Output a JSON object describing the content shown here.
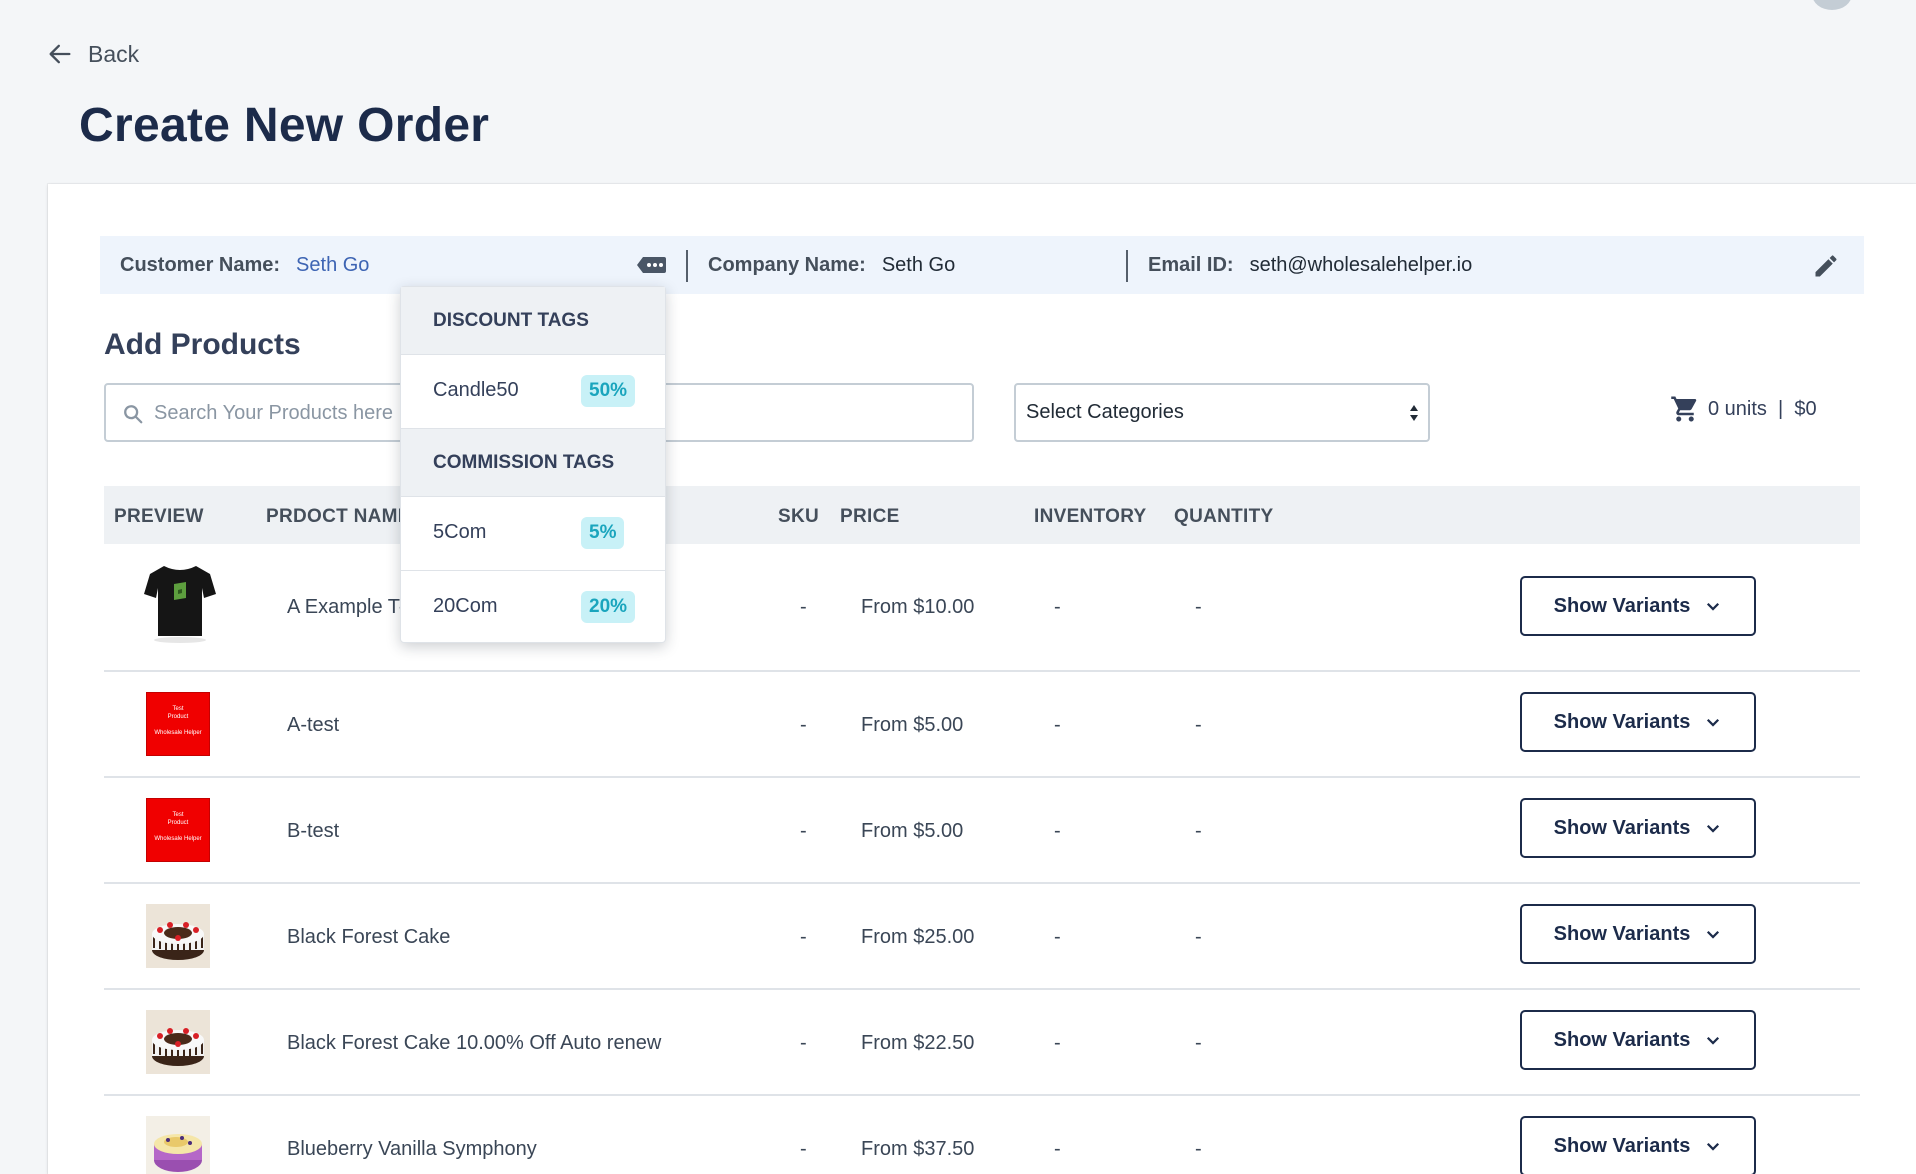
{
  "nav": {
    "back_label": "Back"
  },
  "page": {
    "title": "Create New Order"
  },
  "customer": {
    "customer_label": "Customer Name:",
    "customer_value": "Seth Go",
    "company_label": "Company Name:",
    "company_value": "Seth Go",
    "email_label": "Email ID:",
    "email_value": "seth@wholesalehelper.io"
  },
  "products": {
    "section_title": "Add Products",
    "search_placeholder": "Search Your Products here",
    "category_select": "Select Categories",
    "cart_summary": "0 units  |  $0"
  },
  "table": {
    "headers": {
      "preview": "PREVIEW",
      "name": "PRDOCT NAME",
      "sku": "SKU",
      "price": "PRICE",
      "inventory": "INVENTORY",
      "quantity": "QUANTITY"
    },
    "variants_label": "Show Variants",
    "rows": [
      {
        "name": "A Example T-Shirt",
        "sku": "-",
        "price": "From $10.00",
        "inventory": "-",
        "quantity": "-",
        "thumb": "tshirt-image"
      },
      {
        "name": "A-test",
        "sku": "-",
        "price": "From $5.00",
        "inventory": "-",
        "quantity": "-",
        "thumb": "test-product-image"
      },
      {
        "name": "B-test",
        "sku": "-",
        "price": "From $5.00",
        "inventory": "-",
        "quantity": "-",
        "thumb": "test-product-image"
      },
      {
        "name": "Black Forest Cake",
        "sku": "-",
        "price": "From $25.00",
        "inventory": "-",
        "quantity": "-",
        "thumb": "cake-image"
      },
      {
        "name": "Black Forest Cake 10.00% Off Auto renew",
        "sku": "-",
        "price": "From $22.50",
        "inventory": "-",
        "quantity": "-",
        "thumb": "cake-image"
      },
      {
        "name": "Blueberry Vanilla Symphony",
        "sku": "-",
        "price": "From $37.50",
        "inventory": "-",
        "quantity": "-",
        "thumb": "blueberry-cake-image"
      }
    ]
  },
  "tag_popover": {
    "discount_heading": "DISCOUNT TAGS",
    "discount_tags": [
      {
        "name": "Candle50",
        "percent": "50%"
      }
    ],
    "commission_heading": "COMMISSION TAGS",
    "commission_tags": [
      {
        "name": "5Com",
        "percent": "5%"
      },
      {
        "name": "20Com",
        "percent": "20%"
      }
    ]
  },
  "thumb_text": {
    "line1": "Test",
    "line2": "Product",
    "line3": "Wholesale Helper"
  },
  "colors": {
    "brand_navy": "#1c2b4a",
    "link_blue": "#3d64b3",
    "tag_teal": "#1aa5bd",
    "tag_bg": "#c8f1f7",
    "customer_bar_bg": "#eef4fc"
  }
}
